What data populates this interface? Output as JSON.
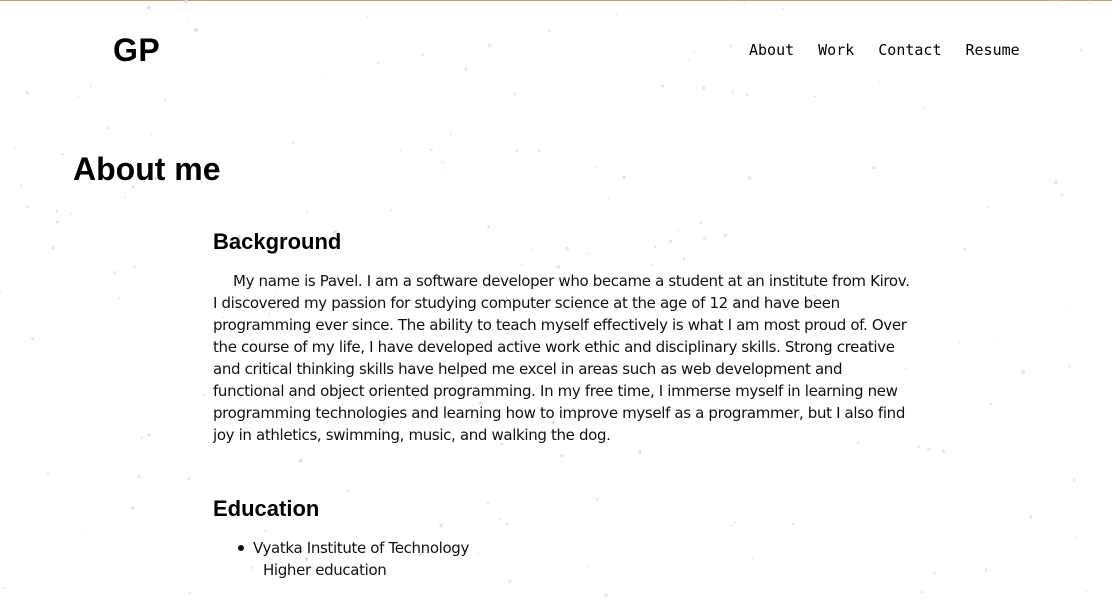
{
  "header": {
    "logo": "GP",
    "nav": [
      "About",
      "Work",
      "Contact",
      "Resume"
    ]
  },
  "main": {
    "title": "About me",
    "background": {
      "heading": "Background",
      "text": "My name is Pavel. I am a software developer who became a student at an institute from Kirov. I discovered my passion for studying computer science at the age of 12 and have been programming ever since. The ability to teach myself effectively is what I am most proud of. Over the course of my life, I have developed active work ethic and disciplinary skills. Strong creative and critical thinking skills have helped me excel in areas such as web development and functional and object oriented programming. In my free time, I immerse myself in learning new programming technologies and learning how to improve myself as a programmer, but I also find joy in athletics, swimming, music, and walking the dog."
    },
    "education": {
      "heading": "Education",
      "items": [
        {
          "institution": "Vyatka Institute of Technology",
          "degree": "Higher education"
        }
      ]
    }
  },
  "colors": {
    "background": "#ffffff",
    "text": "#111111",
    "top_border": "#b9a393",
    "dots": "#d8dde2"
  }
}
